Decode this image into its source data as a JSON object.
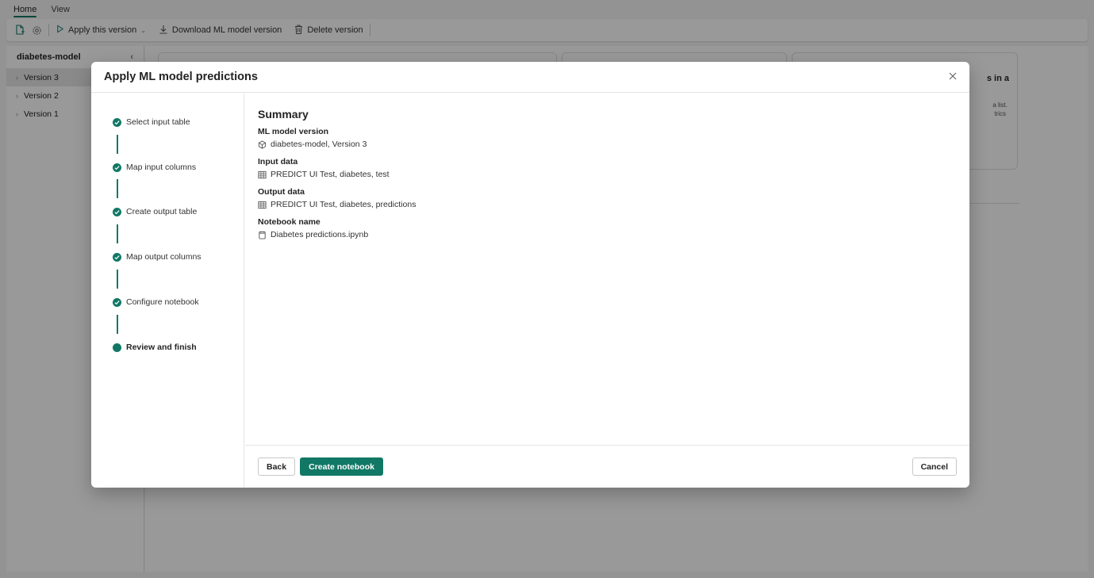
{
  "menubar": {
    "tabs": [
      "Home",
      "View"
    ]
  },
  "toolbar": {
    "apply_label": "Apply this version",
    "download_label": "Download ML model version",
    "delete_label": "Delete version"
  },
  "sidebar": {
    "title": "diabetes-model",
    "items": [
      {
        "label": "Version 3"
      },
      {
        "label": "Version 2"
      },
      {
        "label": "Version 1"
      }
    ]
  },
  "background_card": {
    "partial_title": "s in a",
    "partial_line1": "a list.",
    "partial_line2": "trics"
  },
  "dialog": {
    "title": "Apply ML model predictions",
    "steps": [
      {
        "label": "Select input table",
        "status": "complete"
      },
      {
        "label": "Map input columns",
        "status": "complete"
      },
      {
        "label": "Create output table",
        "status": "complete"
      },
      {
        "label": "Map output columns",
        "status": "complete"
      },
      {
        "label": "Configure notebook",
        "status": "complete"
      },
      {
        "label": "Review and finish",
        "status": "current"
      }
    ],
    "summary": {
      "title": "Summary",
      "fields": [
        {
          "label": "ML model version",
          "value": "diabetes-model, Version 3",
          "icon": "model-icon"
        },
        {
          "label": "Input data",
          "value": "PREDICT UI Test, diabetes, test",
          "icon": "table-icon"
        },
        {
          "label": "Output data",
          "value": "PREDICT UI Test, diabetes, predictions",
          "icon": "table-icon"
        },
        {
          "label": "Notebook name",
          "value": "Diabetes predictions.ipynb",
          "icon": "notebook-icon"
        }
      ]
    },
    "buttons": {
      "back": "Back",
      "create": "Create notebook",
      "cancel": "Cancel"
    }
  },
  "colors": {
    "accent": "#117865"
  }
}
